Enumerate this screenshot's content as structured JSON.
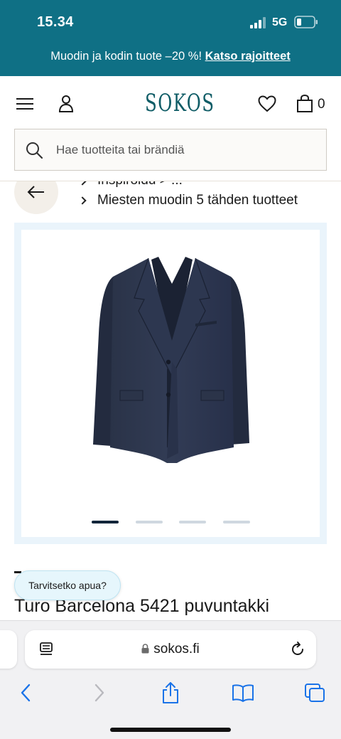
{
  "status_bar": {
    "time": "15.34",
    "network": "5G"
  },
  "promo": {
    "text": "Muodin ja kodin tuote –20 %!",
    "link": "Katso rajoitteet"
  },
  "header": {
    "logo": "SOKOS",
    "cart_count": "0",
    "icons": [
      "menu-icon",
      "account-icon",
      "heart-icon",
      "bag-icon"
    ]
  },
  "search": {
    "placeholder": "Hae tuotteita tai brändiä"
  },
  "breadcrumbs": {
    "partial": "Inspiroidu  >  ...",
    "current": "Miesten muodin 5 tähden tuotteet"
  },
  "gallery": {
    "image_count": 4,
    "active_index": 0
  },
  "help_button": {
    "label": "Tarvitsetko apua?"
  },
  "product": {
    "title": "Turo Barcelona 5421 puvuntakki"
  },
  "browser": {
    "url": "sokos.fi"
  },
  "colors": {
    "accent": "#0f7085",
    "logo": "#0f5c66",
    "safari_blue": "#1a73e8"
  }
}
